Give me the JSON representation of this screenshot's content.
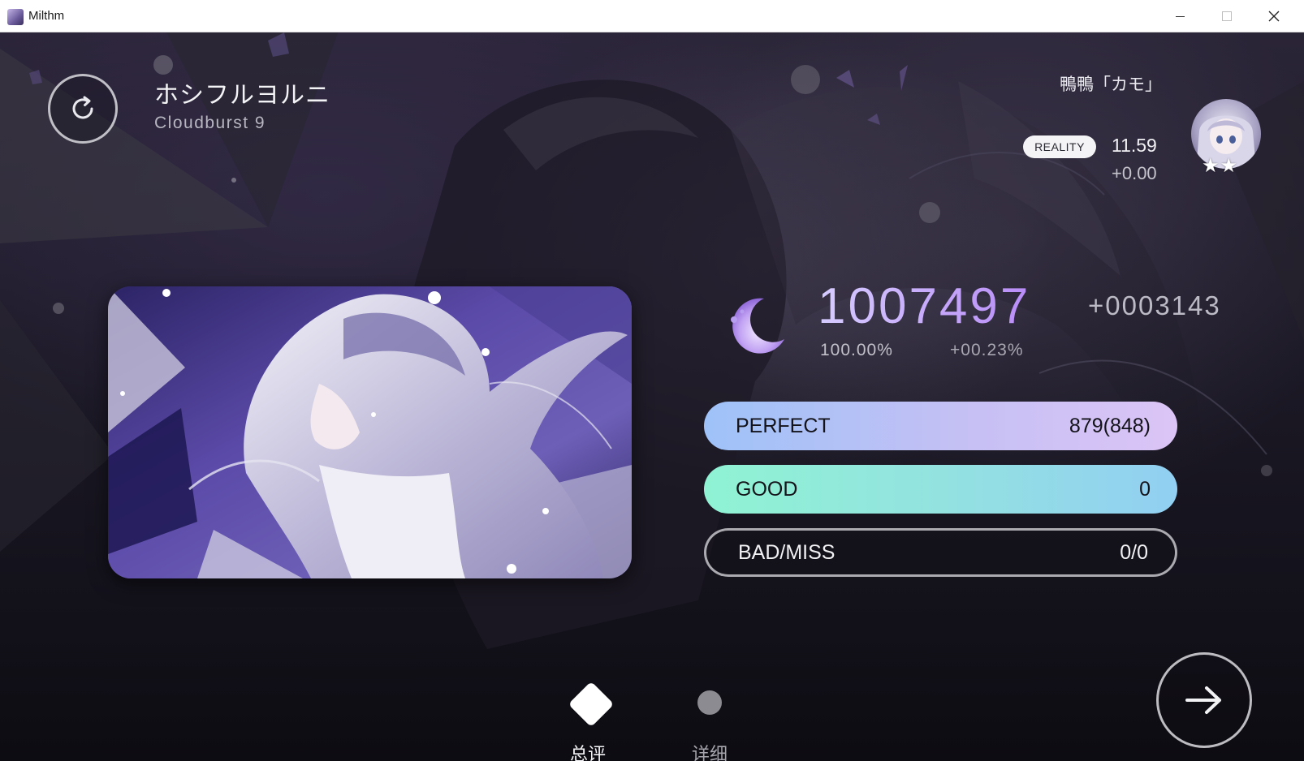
{
  "window": {
    "title": "Milthm",
    "controls": [
      "minimize-icon",
      "maximize-icon",
      "close-icon"
    ]
  },
  "song": {
    "title": "ホシフルヨルニ",
    "difficulty": "Cloudburst 9"
  },
  "player": {
    "name": "鴨鴨「カモ」",
    "badge": "REALITY",
    "rating": "11.59",
    "rating_delta": "+0.00",
    "stars": "★★"
  },
  "result": {
    "score": "1007497",
    "score_delta": "+0003143",
    "accuracy": "100.00%",
    "accuracy_delta": "+00.23%",
    "rank_icon": "crescent-moon-icon"
  },
  "judgements": [
    {
      "label": "PERFECT",
      "value": "879(848)"
    },
    {
      "label": "GOOD",
      "value": "0"
    },
    {
      "label": "BAD/MISS",
      "value": "0/0"
    }
  ],
  "tabs": {
    "overview_label": "总评",
    "details_label": "详细"
  },
  "icons": {
    "retry": "retry-icon",
    "next": "arrow-right-icon"
  },
  "colors": {
    "perfect_start": "#9ec2f8",
    "perfect_end": "#dcc4f6",
    "good_start": "#8ff3d3",
    "good_end": "#92cff2",
    "score_gradient_start": "#d6ccff",
    "score_gradient_end": "#b98cf7"
  }
}
